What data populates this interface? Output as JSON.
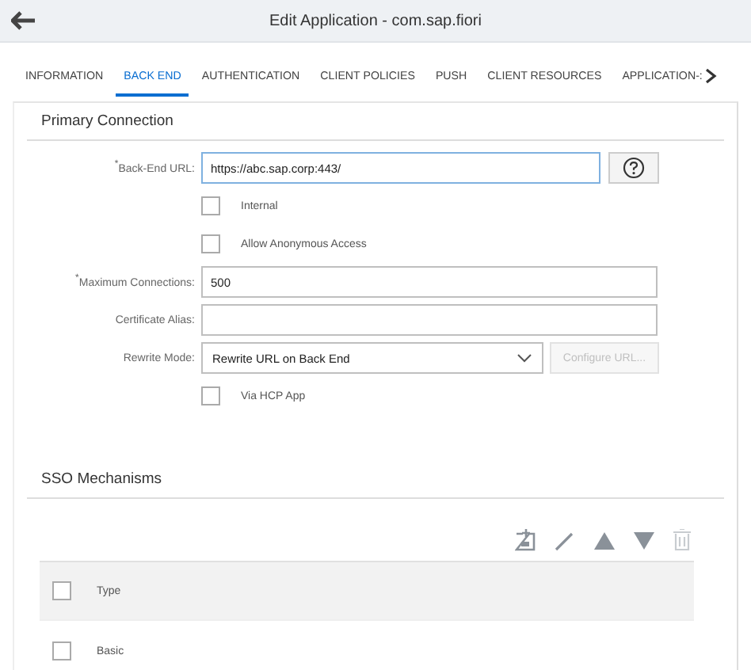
{
  "window": {
    "title": "Edit Application - com.sap.fiori"
  },
  "tabs": [
    {
      "label": "INFORMATION",
      "selected": false
    },
    {
      "label": "BACK END",
      "selected": true
    },
    {
      "label": "AUTHENTICATION",
      "selected": false
    },
    {
      "label": "CLIENT POLICIES",
      "selected": false
    },
    {
      "label": "PUSH",
      "selected": false
    },
    {
      "label": "CLIENT RESOURCES",
      "selected": false
    },
    {
      "label": "APPLICATION-:",
      "selected": false
    }
  ],
  "primary": {
    "title": "Primary Connection",
    "rows": [
      {
        "kind": "input",
        "label": "$^{*}$Back-End URL:",
        "value": "https://abc.sap.corp:443/",
        "help": true
      },
      {
        "kind": "checkbox",
        "label": "Internal",
        "checked": false
      },
      {
        "kind": "checkbox",
        "label": "Allow Anonymous Access",
        "checked": false
      },
      {
        "kind": "input",
        "label": "$^{*}$Maximum Connections:",
        "value": "500",
        "help": false
      },
      {
        "kind": "input",
        "label": "Certificate Alias:",
        "value": "",
        "help": false
      },
      {
        "kind": "select",
        "label": "Rewrite Mode:",
        "value": "Rewrite URL on Back End",
        "button": "Configure URL...",
        "button_disabled": true
      },
      {
        "kind": "checkbox",
        "label": "Via HCP App",
        "checked": false
      }
    ]
  },
  "sso": {
    "title": "SSO Mechanisms",
    "toolbar": [
      {
        "kind": "add",
        "disabled": false
      },
      {
        "kind": "edit",
        "disabled": false
      },
      {
        "kind": "up",
        "disabled": false
      },
      {
        "kind": "down",
        "disabled": false
      },
      {
        "kind": "delete",
        "disabled": true
      }
    ],
    "header": {
      "label": "Type",
      "checked": false
    },
    "rows": [
      {
        "label": "Basic",
        "checked": false
      }
    ]
  }
}
